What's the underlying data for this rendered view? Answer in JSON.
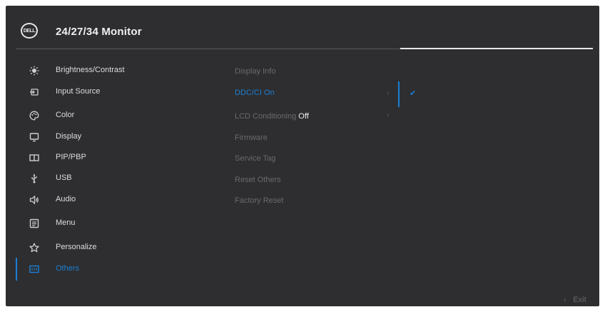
{
  "header": {
    "logo_text": "DELL",
    "title": "24/27/34 Monitor"
  },
  "menu": {
    "items": [
      {
        "label": "Brightness/Contrast",
        "icon": "brightness-icon"
      },
      {
        "label": "Input Source",
        "icon": "input-source-icon"
      },
      {
        "label": "Color",
        "icon": "color-icon"
      },
      {
        "label": "Display",
        "icon": "display-icon"
      },
      {
        "label": "PIP/PBP",
        "icon": "pip-pbp-icon"
      },
      {
        "label": "USB",
        "icon": "usb-icon"
      },
      {
        "label": "Audio",
        "icon": "audio-icon"
      },
      {
        "label": "Menu",
        "icon": "menu-icon"
      },
      {
        "label": "Personalize",
        "icon": "personalize-icon"
      },
      {
        "label": "Others",
        "icon": "others-icon",
        "active": true
      }
    ]
  },
  "submenu": {
    "display_info": "Display Info",
    "ddc_ci": "DDC/CI On",
    "lcd_conditioning": "LCD Conditioning",
    "lcd_conditioning_value": "Off",
    "firmware": "Firmware",
    "service_tag": "Service Tag",
    "reset_others": "Reset Others",
    "factory_reset": "Factory Reset"
  },
  "glyphs": {
    "chevron_right": "›",
    "check": "✔",
    "back_arrow": "‹"
  },
  "footer": {
    "exit_label": "Exit"
  },
  "colors": {
    "background": "#2e2e30",
    "accent": "#1a7fd4",
    "text": "#dcdcdc",
    "dim_text": "#6a6a6c"
  }
}
